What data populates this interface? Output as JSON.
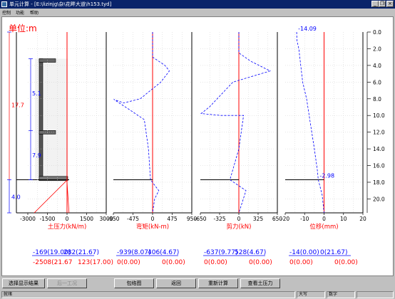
{
  "window": {
    "title": "单元计算 - [E:\\lizinjg\\杂\\花畔大道\\h153.tyd]",
    "controls": [
      "_",
      "❐",
      "×"
    ]
  },
  "menu": [
    "控制",
    "功能",
    "帮助"
  ],
  "unit_label": "单位:m",
  "profile": {
    "dim_top": "17.7",
    "dim_bottom": "4.0",
    "dim_seg1": "5.1",
    "dim_seg2": "7.9"
  },
  "chart_data": [
    {
      "type": "line",
      "xlabel": "土压力(kN/m)",
      "x_ticks": [
        "-3000",
        "-1500",
        "0",
        "1500",
        "3000"
      ],
      "xlim": [
        -3000,
        3000
      ],
      "series": [
        {
          "points": [
            [
              0,
              0
            ],
            [
              0,
              17.7
            ],
            [
              -30,
              17.8
            ],
            [
              -2508,
              21.67
            ]
          ]
        },
        {
          "points": [
            [
              0,
              0
            ],
            [
              0,
              18.0
            ],
            [
              150,
              21.67
            ]
          ]
        }
      ]
    },
    {
      "type": "line",
      "xlabel": "弯矩(kN-m)",
      "x_ticks": [
        "-950",
        "-475",
        "0",
        "475",
        "950"
      ],
      "xlim": [
        -950,
        950
      ],
      "series": [
        {
          "points": [
            [
              0,
              0
            ],
            [
              0,
              3.0
            ],
            [
              300,
              4.0
            ],
            [
              406,
              4.67
            ],
            [
              200,
              6.0
            ],
            [
              -300,
              8.0
            ],
            [
              -700,
              8.5
            ],
            [
              -939,
              8.07
            ],
            [
              -500,
              9.5
            ],
            [
              -200,
              10.5
            ],
            [
              -100,
              14.0
            ],
            [
              -50,
              17.7
            ],
            [
              150,
              19.0
            ],
            [
              50,
              20.0
            ],
            [
              0,
              21.67
            ]
          ]
        }
      ]
    },
    {
      "type": "line",
      "xlabel": "剪力(kN)",
      "x_ticks": [
        "-650",
        "-325",
        "0",
        "325",
        "650"
      ],
      "xlim": [
        -650,
        650
      ],
      "series": [
        {
          "points": [
            [
              0,
              0
            ],
            [
              0,
              2.5
            ],
            [
              200,
              3.5
            ],
            [
              528,
              4.67
            ],
            [
              -100,
              6.0
            ],
            [
              -500,
              9.0
            ],
            [
              -637,
              9.77
            ],
            [
              -300,
              10.0
            ],
            [
              80,
              10.0
            ],
            [
              0,
              14.0
            ],
            [
              -150,
              17.7
            ],
            [
              120,
              19.0
            ],
            [
              0,
              21.67
            ]
          ]
        }
      ]
    },
    {
      "type": "line",
      "xlabel": "位移(mm)",
      "x_ticks": [
        "-20",
        "-10",
        "0",
        "10",
        "20"
      ],
      "xlim": [
        -20,
        20
      ],
      "series": [
        {
          "points": [
            [
              -14.09,
              0
            ],
            [
              -14,
              1
            ],
            [
              -13,
              2
            ],
            [
              -12,
              4
            ],
            [
              -11,
              6
            ],
            [
              -9,
              8
            ],
            [
              -7,
              11
            ],
            [
              -5,
              14
            ],
            [
              -3.5,
              16.5
            ],
            [
              -2.98,
              17.7
            ],
            [
              -1,
              19.5
            ],
            [
              0,
              21.67
            ]
          ]
        }
      ],
      "annotations": [
        "-14.09",
        "-2.98"
      ]
    }
  ],
  "depth_axis": [
    "0.0",
    "2.0",
    "4.0",
    "6.0",
    "8.0",
    "10.0",
    "12.0",
    "14.0",
    "16.0",
    "18.0",
    "20.0"
  ],
  "results": {
    "earth": {
      "max": "-169(19.00)",
      "max2": "282(21.67)",
      "min": "-2508(21.67",
      "min2": "123(17.00)"
    },
    "moment": {
      "max": "-939(8.07)",
      "max2": "406(4.67)",
      "min": "0(0.00)",
      "min2": "0(0.00)"
    },
    "shear": {
      "max": "-637(9.77)",
      "max2": "528(4.67)",
      "min": "0(0.00)",
      "min2": "0(0.00)"
    },
    "disp": {
      "max": "-14(0.00)",
      "max2": "0(21.67)",
      "min": "0(0.00)",
      "min2": "0(0.00)"
    }
  },
  "buttons": {
    "select": "选择显示结果",
    "next": "后一工况",
    "wrap": "包络图",
    "back": "返回",
    "recalc": "重新计算",
    "view": "查看土压力"
  },
  "status": {
    "left": "就绪",
    "caps": "大写",
    "num": "数字"
  },
  "colors": {
    "title_bar": "#0a246a",
    "curve_blue": "#0000ff",
    "curve_red": "#ff0000",
    "label_red": "#ff0000"
  }
}
